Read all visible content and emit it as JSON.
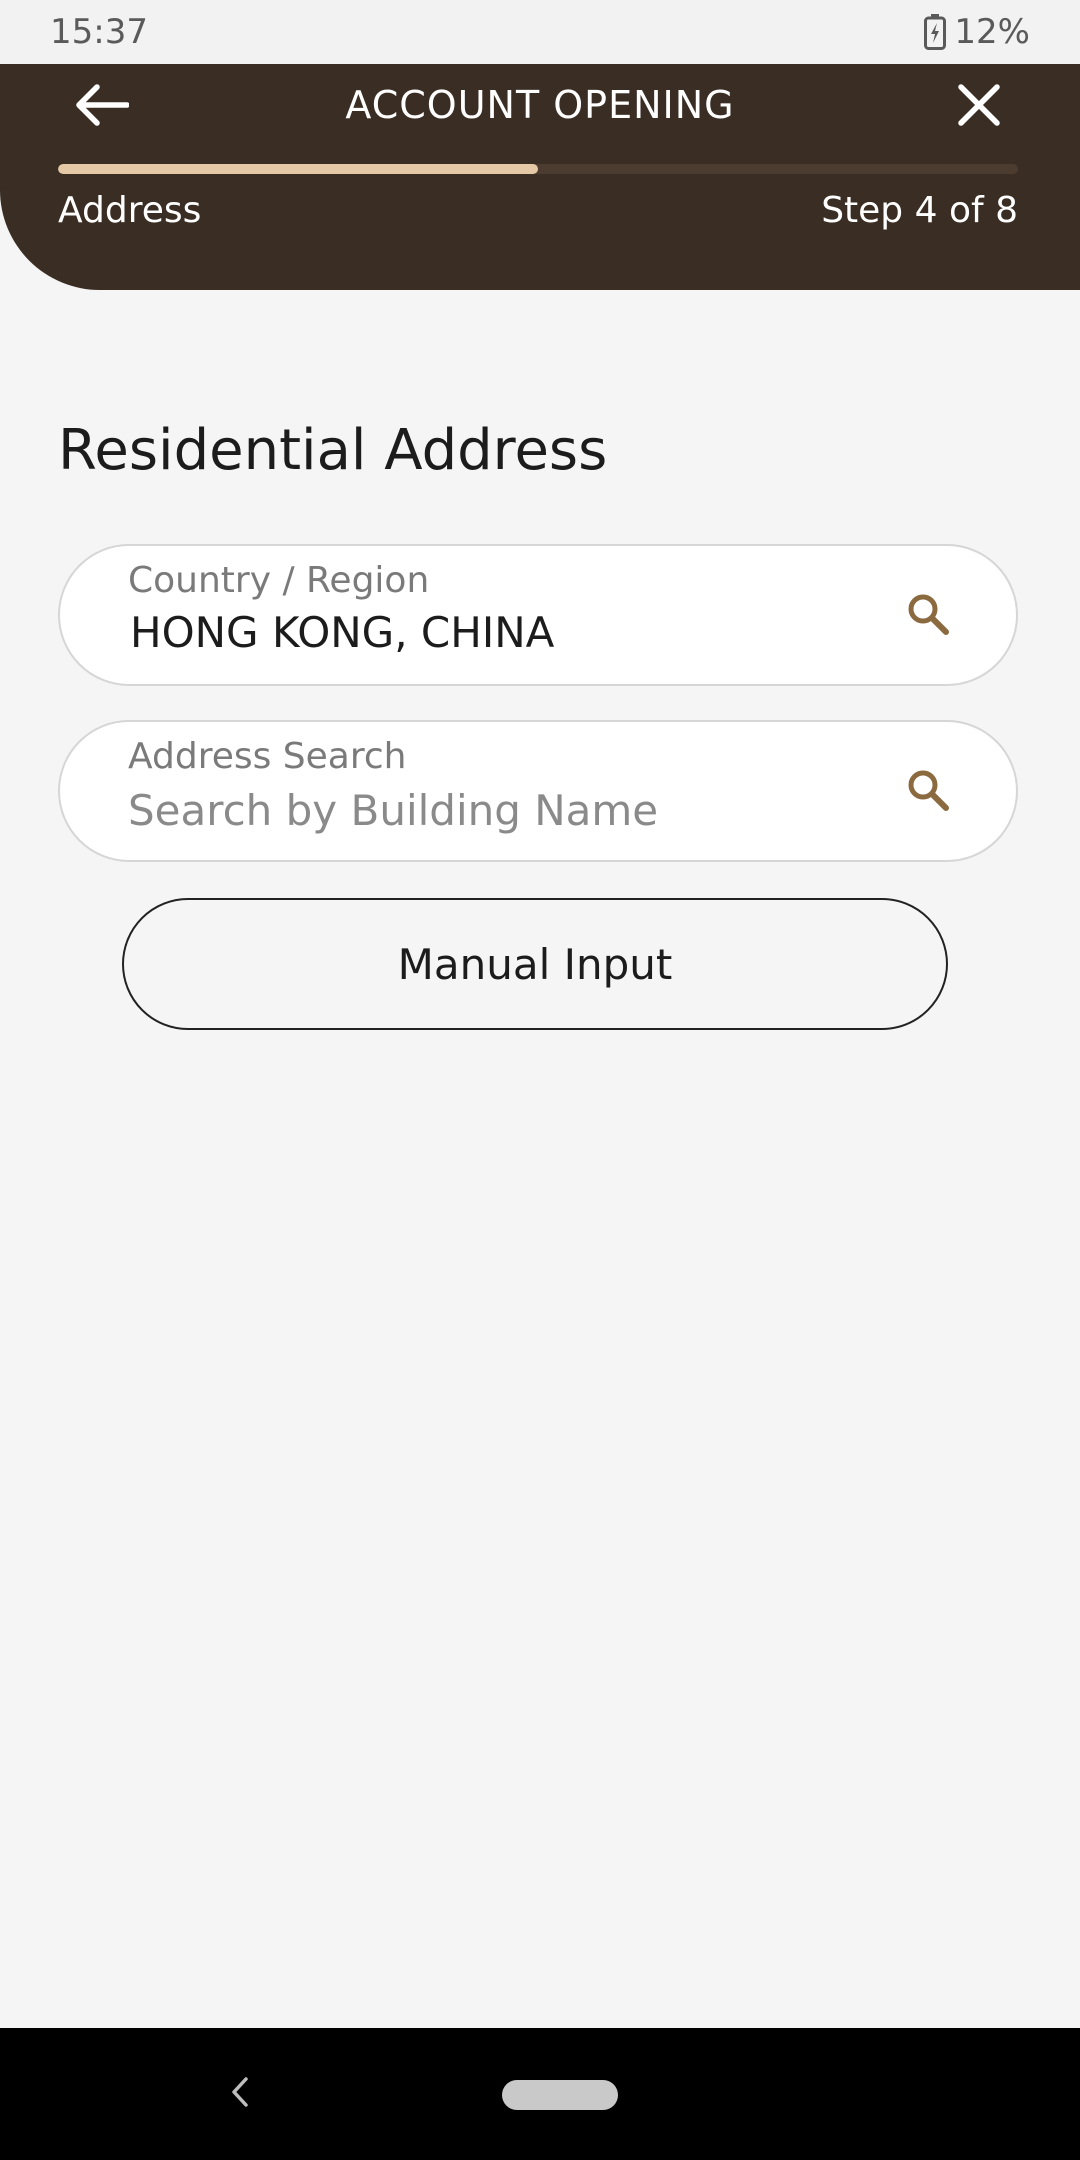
{
  "status_bar": {
    "time": "15:37",
    "battery": "12%",
    "battery_icon": "battery-charging-icon"
  },
  "header": {
    "title": "ACCOUNT OPENING",
    "back_icon": "arrow-left-icon",
    "close_icon": "close-icon",
    "step_name": "Address",
    "step_count": "Step 4 of 8",
    "progress_fraction": 0.5,
    "background_color": "#3a2d23",
    "progress_color": "#e5c9a6"
  },
  "main": {
    "section_title": "Residential Address",
    "country_field": {
      "label": "Country / Region",
      "value": "HONG KONG, CHINA",
      "icon": "search-icon"
    },
    "address_field": {
      "label": "Address Search",
      "value": "",
      "placeholder": "Search by Building Name",
      "icon": "search-icon"
    },
    "manual_input_label": "Manual Input",
    "accent_color": "#8a6a3e"
  },
  "nav_bar": {
    "back_icon": "chevron-left-icon",
    "home_icon": "home-pill-icon"
  }
}
